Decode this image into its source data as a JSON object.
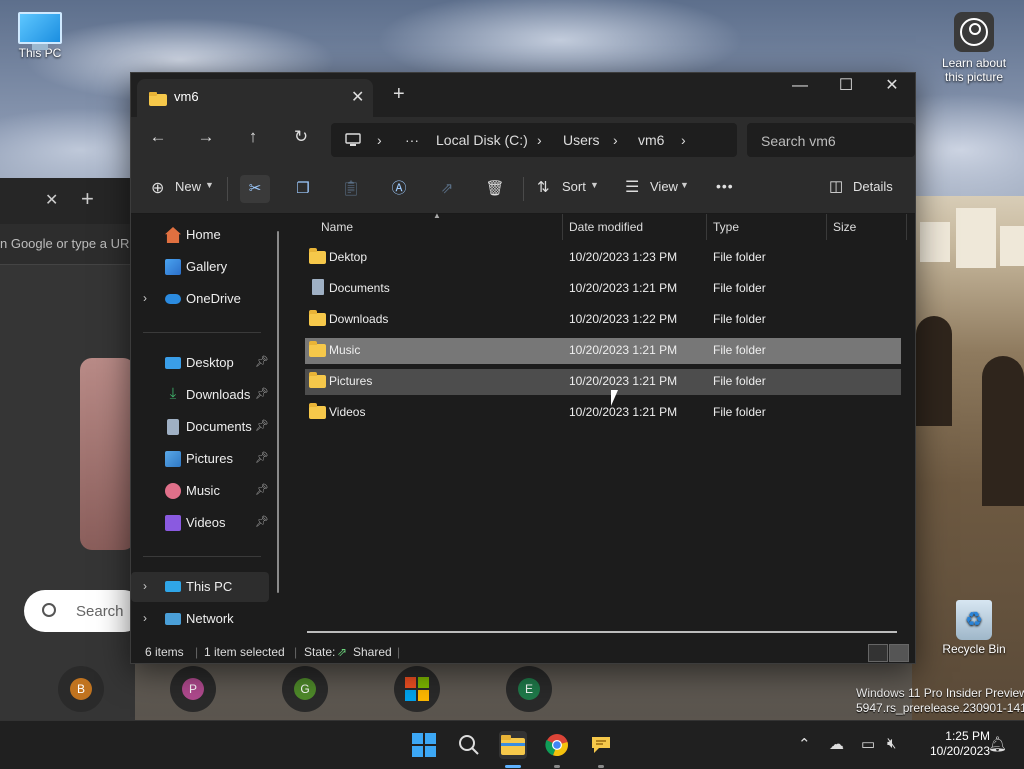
{
  "desktop": {
    "icons": {
      "this_pc": "This PC",
      "learn": "Learn about this picture",
      "recycle_bin": "Recycle Bin"
    },
    "watermark": {
      "line1": "Windows 11 Pro Insider Preview",
      "line2": "5947.rs_prerelease.230901-1416"
    }
  },
  "browser": {
    "address_partial": "n Google or type a UR",
    "search_partial": "Search",
    "shortcuts": [
      "B",
      "P",
      "G",
      "",
      "E"
    ],
    "shortcut_colors": [
      "#c0731f",
      "#b04a8e",
      "#4f8a2a",
      "",
      "#1f7a4a"
    ]
  },
  "explorer": {
    "tab_title": "vm6",
    "window_controls": {
      "minimize": "—",
      "maximize": "☐",
      "close": "✕"
    },
    "breadcrumbs": [
      "Local Disk (C:)",
      "Users",
      "vm6"
    ],
    "search_placeholder": "Search vm6",
    "commands": {
      "new": "New",
      "sort": "Sort",
      "view": "View",
      "details": "Details",
      "more": "•••"
    },
    "sidebar": {
      "home": "Home",
      "gallery": "Gallery",
      "onedrive": "OneDrive",
      "pinned": [
        {
          "label": "Desktop",
          "icon": "desktop-icon",
          "color": "#3a9ee8"
        },
        {
          "label": "Downloads",
          "icon": "download-icon",
          "color": "#3fb36b"
        },
        {
          "label": "Documents",
          "icon": "document-icon",
          "color": "#9fb0c4"
        },
        {
          "label": "Pictures",
          "icon": "pictures-icon",
          "color": "#5aa8e8"
        },
        {
          "label": "Music",
          "icon": "music-icon",
          "color": "#e0708a"
        },
        {
          "label": "Videos",
          "icon": "videos-icon",
          "color": "#8a5ae0"
        }
      ],
      "this_pc": "This PC",
      "network": "Network"
    },
    "columns": {
      "name": "Name",
      "date": "Date modified",
      "type": "Type",
      "size": "Size"
    },
    "files": [
      {
        "name": "Dektop",
        "date": "10/20/2023 1:23 PM",
        "type": "File folder",
        "icon": "folder-icon"
      },
      {
        "name": "Documents",
        "date": "10/20/2023 1:21 PM",
        "type": "File folder",
        "icon": "document-folder-icon"
      },
      {
        "name": "Downloads",
        "date": "10/20/2023 1:22 PM",
        "type": "File folder",
        "icon": "folder-icon"
      },
      {
        "name": "Music",
        "date": "10/20/2023 1:21 PM",
        "type": "File folder",
        "icon": "folder-icon",
        "state": "selected"
      },
      {
        "name": "Pictures",
        "date": "10/20/2023 1:21 PM",
        "type": "File folder",
        "icon": "folder-icon",
        "state": "hover"
      },
      {
        "name": "Videos",
        "date": "10/20/2023 1:21 PM",
        "type": "File folder",
        "icon": "folder-icon"
      }
    ],
    "status": {
      "items": "6 items",
      "selected": "1 item selected",
      "state_label": "State:",
      "state_value": "Shared"
    }
  },
  "taskbar": {
    "time": "1:25 PM",
    "date": "10/20/2023"
  }
}
